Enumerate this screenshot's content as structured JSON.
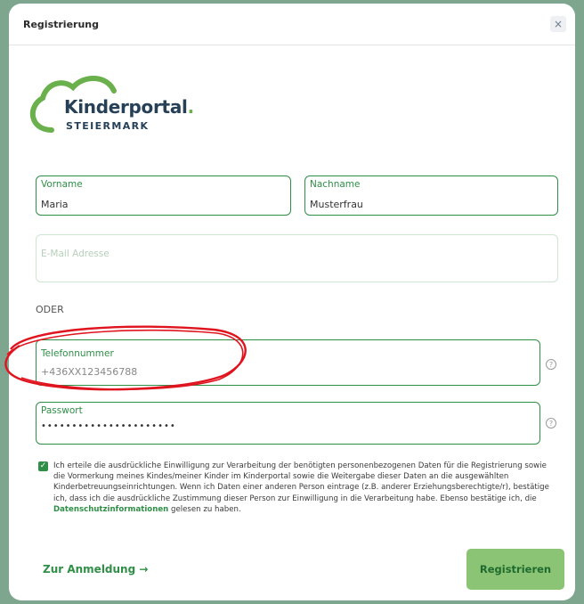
{
  "dialog": {
    "title": "Registrierung",
    "close_label": "×"
  },
  "logo": {
    "name": "Kinderportal",
    "dot": ".",
    "subtitle": "STEIERMARK"
  },
  "form": {
    "first_name": {
      "label": "Vorname",
      "value": "Maria"
    },
    "last_name": {
      "label": "Nachname",
      "value": "Musterfrau"
    },
    "email": {
      "placeholder": "E-Mail Adresse"
    },
    "separator": "ODER",
    "phone": {
      "label": "Telefonnummer",
      "value": "+436XX123456788"
    },
    "password": {
      "label": "Passwort",
      "value": "••••••••••••••••••••••"
    },
    "help_glyph": "?"
  },
  "consent": {
    "checked": true,
    "check_glyph": "✓",
    "text": "Ich erteile die ausdrückliche Einwilligung zur Verarbeitung der benötigten personenbezogenen Daten für die Registrierung sowie die Vormerkung meines Kindes/meiner Kinder im Kinderportal sowie die Weitergabe dieser Daten an die ausgewählten Kinderbetreuungseinrichtungen. Wenn ich Daten einer anderen Person eintrage (z.B. anderer Erziehungsberechtigte/r), bestätige ich, dass ich die ausdrückliche Zustimmung dieser Person zur Einwilligung in die Verarbeitung habe. Ebenso bestätige ich, die",
    "link": "Datenschutzinformationen",
    "suffix": "gelesen zu haben."
  },
  "footer": {
    "login_link": "Zur Anmeldung →",
    "register_button": "Registrieren"
  },
  "colors": {
    "accent": "#2f8f47",
    "button": "#8bc474",
    "background": "#7ea68e",
    "annotation": "#e0141e"
  }
}
